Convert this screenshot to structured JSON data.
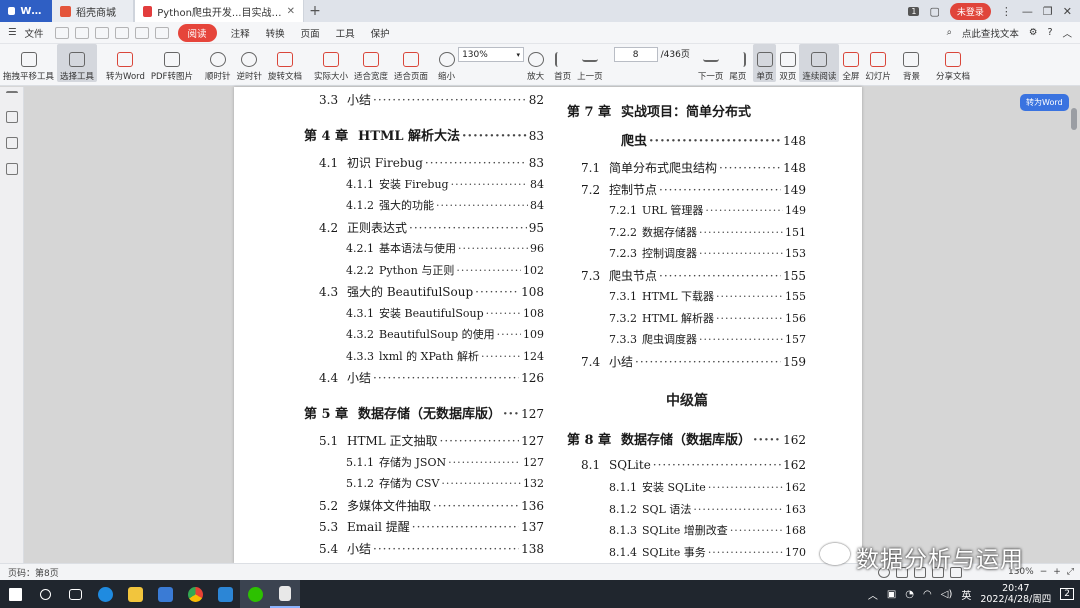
{
  "tabs": [
    {
      "label": "WPS"
    },
    {
      "label": "稻壳商城"
    },
    {
      "label": "Python爬虫开发...目实战(1).pdf"
    }
  ],
  "window": {
    "badge": "1",
    "login": "未登录"
  },
  "menu": {
    "file": "文件",
    "read_button": "阅读",
    "items": [
      "注释",
      "转换",
      "页面",
      "工具",
      "保护"
    ],
    "search_hint": "点此查找文本"
  },
  "toolbar": {
    "items": [
      "拖拽平移工具",
      "选择工具",
      "转为Word",
      "PDF转图片",
      "顺时针",
      "逆时针",
      "旋转文档",
      "实际大小",
      "适合宽度",
      "适合页面",
      "缩小"
    ],
    "zoom": "130%",
    "zoom_in": "放大",
    "first": "首页",
    "prev": "上一页",
    "page_current": "8",
    "page_total": "/436页",
    "next": "下一页",
    "last": "尾页",
    "single": "单页",
    "double": "双页",
    "continuous": "连续阅读",
    "fullscreen": "全屏",
    "slides": "幻灯片",
    "background": "背景",
    "share": "分享文档"
  },
  "to_word_float": "转为Word",
  "toc_left": [
    {
      "num": "3.3",
      "title": "小结",
      "page": "82",
      "kind": "sec"
    },
    {
      "num": "第 4 章",
      "title": "HTML 解析大法",
      "page": "83",
      "kind": "chap"
    },
    {
      "num": "4.1",
      "title": "初识 Firebug",
      "page": "83",
      "kind": "sec"
    },
    {
      "num": "4.1.1",
      "title": "安装 Firebug",
      "page": "84",
      "kind": "sub"
    },
    {
      "num": "4.1.2",
      "title": "强大的功能",
      "page": "84",
      "kind": "sub"
    },
    {
      "num": "4.2",
      "title": "正则表达式",
      "page": "95",
      "kind": "sec"
    },
    {
      "num": "4.2.1",
      "title": "基本语法与使用",
      "page": "96",
      "kind": "sub"
    },
    {
      "num": "4.2.2",
      "title": "Python 与正则",
      "page": "102",
      "kind": "sub"
    },
    {
      "num": "4.3",
      "title": "强大的 BeautifulSoup",
      "page": "108",
      "kind": "sec"
    },
    {
      "num": "4.3.1",
      "title": "安装 BeautifulSoup",
      "page": "108",
      "kind": "sub"
    },
    {
      "num": "4.3.2",
      "title": "BeautifulSoup 的使用",
      "page": "109",
      "kind": "sub"
    },
    {
      "num": "4.3.3",
      "title": "lxml 的 XPath 解析",
      "page": "124",
      "kind": "sub"
    },
    {
      "num": "4.4",
      "title": "小结",
      "page": "126",
      "kind": "sec"
    },
    {
      "num": "第 5 章",
      "title": "数据存储（无数据库版）",
      "page": "127",
      "kind": "chap"
    },
    {
      "num": "5.1",
      "title": "HTML 正文抽取",
      "page": "127",
      "kind": "sec"
    },
    {
      "num": "5.1.1",
      "title": "存储为 JSON",
      "page": "127",
      "kind": "sub"
    },
    {
      "num": "5.1.2",
      "title": "存储为 CSV",
      "page": "132",
      "kind": "sub"
    },
    {
      "num": "5.2",
      "title": "多媒体文件抽取",
      "page": "136",
      "kind": "sec"
    },
    {
      "num": "5.3",
      "title": "Email 提醒",
      "page": "137",
      "kind": "sec"
    },
    {
      "num": "5.4",
      "title": "小结",
      "page": "138",
      "kind": "sec"
    }
  ],
  "toc_right": [
    {
      "num": "第 7 章",
      "title": "实战项目：简单分布式",
      "page": "",
      "kind": "chap"
    },
    {
      "num": "",
      "title": "爬虫",
      "page": "148",
      "kind": "chapcont"
    },
    {
      "num": "7.1",
      "title": "简单分布式爬虫结构",
      "page": "148",
      "kind": "sec"
    },
    {
      "num": "7.2",
      "title": "控制节点",
      "page": "149",
      "kind": "sec"
    },
    {
      "num": "7.2.1",
      "title": "URL 管理器",
      "page": "149",
      "kind": "sub"
    },
    {
      "num": "7.2.2",
      "title": "数据存储器",
      "page": "151",
      "kind": "sub"
    },
    {
      "num": "7.2.3",
      "title": "控制调度器",
      "page": "153",
      "kind": "sub"
    },
    {
      "num": "7.3",
      "title": "爬虫节点",
      "page": "155",
      "kind": "sec"
    },
    {
      "num": "7.3.1",
      "title": "HTML 下载器",
      "page": "155",
      "kind": "sub"
    },
    {
      "num": "7.3.2",
      "title": "HTML 解析器",
      "page": "156",
      "kind": "sub"
    },
    {
      "num": "7.3.3",
      "title": "爬虫调度器",
      "page": "157",
      "kind": "sub"
    },
    {
      "num": "7.4",
      "title": "小结",
      "page": "159",
      "kind": "sec"
    },
    {
      "num": "第 8 章",
      "title": "数据存储（数据库版）",
      "page": "162",
      "kind": "chap"
    },
    {
      "num": "8.1",
      "title": "SQLite",
      "page": "162",
      "kind": "sec"
    },
    {
      "num": "8.1.1",
      "title": "安装 SQLite",
      "page": "162",
      "kind": "sub"
    },
    {
      "num": "8.1.2",
      "title": "SQL 语法",
      "page": "163",
      "kind": "sub"
    },
    {
      "num": "8.1.3",
      "title": "SQLite 增删改查",
      "page": "168",
      "kind": "sub"
    },
    {
      "num": "8.1.4",
      "title": "SQLite 事务",
      "page": "170",
      "kind": "sub"
    }
  ],
  "section_head": "中级篇",
  "status": {
    "page_label": "页码：第8页",
    "zoom_small": "130%"
  },
  "watermark": "数据分析与运用",
  "tray": {
    "lang": "英",
    "time": "20:47",
    "date": "2022/4/28/周四",
    "notif": "2"
  }
}
